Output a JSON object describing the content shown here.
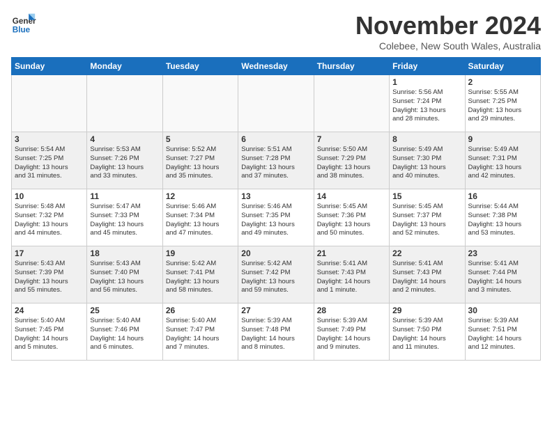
{
  "logo": {
    "line1": "General",
    "line2": "Blue"
  },
  "title": "November 2024",
  "location": "Colebee, New South Wales, Australia",
  "days_of_week": [
    "Sunday",
    "Monday",
    "Tuesday",
    "Wednesday",
    "Thursday",
    "Friday",
    "Saturday"
  ],
  "weeks": [
    [
      {
        "day": "",
        "info": ""
      },
      {
        "day": "",
        "info": ""
      },
      {
        "day": "",
        "info": ""
      },
      {
        "day": "",
        "info": ""
      },
      {
        "day": "",
        "info": ""
      },
      {
        "day": "1",
        "info": "Sunrise: 5:56 AM\nSunset: 7:24 PM\nDaylight: 13 hours\nand 28 minutes."
      },
      {
        "day": "2",
        "info": "Sunrise: 5:55 AM\nSunset: 7:25 PM\nDaylight: 13 hours\nand 29 minutes."
      }
    ],
    [
      {
        "day": "3",
        "info": "Sunrise: 5:54 AM\nSunset: 7:25 PM\nDaylight: 13 hours\nand 31 minutes."
      },
      {
        "day": "4",
        "info": "Sunrise: 5:53 AM\nSunset: 7:26 PM\nDaylight: 13 hours\nand 33 minutes."
      },
      {
        "day": "5",
        "info": "Sunrise: 5:52 AM\nSunset: 7:27 PM\nDaylight: 13 hours\nand 35 minutes."
      },
      {
        "day": "6",
        "info": "Sunrise: 5:51 AM\nSunset: 7:28 PM\nDaylight: 13 hours\nand 37 minutes."
      },
      {
        "day": "7",
        "info": "Sunrise: 5:50 AM\nSunset: 7:29 PM\nDaylight: 13 hours\nand 38 minutes."
      },
      {
        "day": "8",
        "info": "Sunrise: 5:49 AM\nSunset: 7:30 PM\nDaylight: 13 hours\nand 40 minutes."
      },
      {
        "day": "9",
        "info": "Sunrise: 5:49 AM\nSunset: 7:31 PM\nDaylight: 13 hours\nand 42 minutes."
      }
    ],
    [
      {
        "day": "10",
        "info": "Sunrise: 5:48 AM\nSunset: 7:32 PM\nDaylight: 13 hours\nand 44 minutes."
      },
      {
        "day": "11",
        "info": "Sunrise: 5:47 AM\nSunset: 7:33 PM\nDaylight: 13 hours\nand 45 minutes."
      },
      {
        "day": "12",
        "info": "Sunrise: 5:46 AM\nSunset: 7:34 PM\nDaylight: 13 hours\nand 47 minutes."
      },
      {
        "day": "13",
        "info": "Sunrise: 5:46 AM\nSunset: 7:35 PM\nDaylight: 13 hours\nand 49 minutes."
      },
      {
        "day": "14",
        "info": "Sunrise: 5:45 AM\nSunset: 7:36 PM\nDaylight: 13 hours\nand 50 minutes."
      },
      {
        "day": "15",
        "info": "Sunrise: 5:45 AM\nSunset: 7:37 PM\nDaylight: 13 hours\nand 52 minutes."
      },
      {
        "day": "16",
        "info": "Sunrise: 5:44 AM\nSunset: 7:38 PM\nDaylight: 13 hours\nand 53 minutes."
      }
    ],
    [
      {
        "day": "17",
        "info": "Sunrise: 5:43 AM\nSunset: 7:39 PM\nDaylight: 13 hours\nand 55 minutes."
      },
      {
        "day": "18",
        "info": "Sunrise: 5:43 AM\nSunset: 7:40 PM\nDaylight: 13 hours\nand 56 minutes."
      },
      {
        "day": "19",
        "info": "Sunrise: 5:42 AM\nSunset: 7:41 PM\nDaylight: 13 hours\nand 58 minutes."
      },
      {
        "day": "20",
        "info": "Sunrise: 5:42 AM\nSunset: 7:42 PM\nDaylight: 13 hours\nand 59 minutes."
      },
      {
        "day": "21",
        "info": "Sunrise: 5:41 AM\nSunset: 7:43 PM\nDaylight: 14 hours\nand 1 minute."
      },
      {
        "day": "22",
        "info": "Sunrise: 5:41 AM\nSunset: 7:43 PM\nDaylight: 14 hours\nand 2 minutes."
      },
      {
        "day": "23",
        "info": "Sunrise: 5:41 AM\nSunset: 7:44 PM\nDaylight: 14 hours\nand 3 minutes."
      }
    ],
    [
      {
        "day": "24",
        "info": "Sunrise: 5:40 AM\nSunset: 7:45 PM\nDaylight: 14 hours\nand 5 minutes."
      },
      {
        "day": "25",
        "info": "Sunrise: 5:40 AM\nSunset: 7:46 PM\nDaylight: 14 hours\nand 6 minutes."
      },
      {
        "day": "26",
        "info": "Sunrise: 5:40 AM\nSunset: 7:47 PM\nDaylight: 14 hours\nand 7 minutes."
      },
      {
        "day": "27",
        "info": "Sunrise: 5:39 AM\nSunset: 7:48 PM\nDaylight: 14 hours\nand 8 minutes."
      },
      {
        "day": "28",
        "info": "Sunrise: 5:39 AM\nSunset: 7:49 PM\nDaylight: 14 hours\nand 9 minutes."
      },
      {
        "day": "29",
        "info": "Sunrise: 5:39 AM\nSunset: 7:50 PM\nDaylight: 14 hours\nand 11 minutes."
      },
      {
        "day": "30",
        "info": "Sunrise: 5:39 AM\nSunset: 7:51 PM\nDaylight: 14 hours\nand 12 minutes."
      }
    ]
  ]
}
